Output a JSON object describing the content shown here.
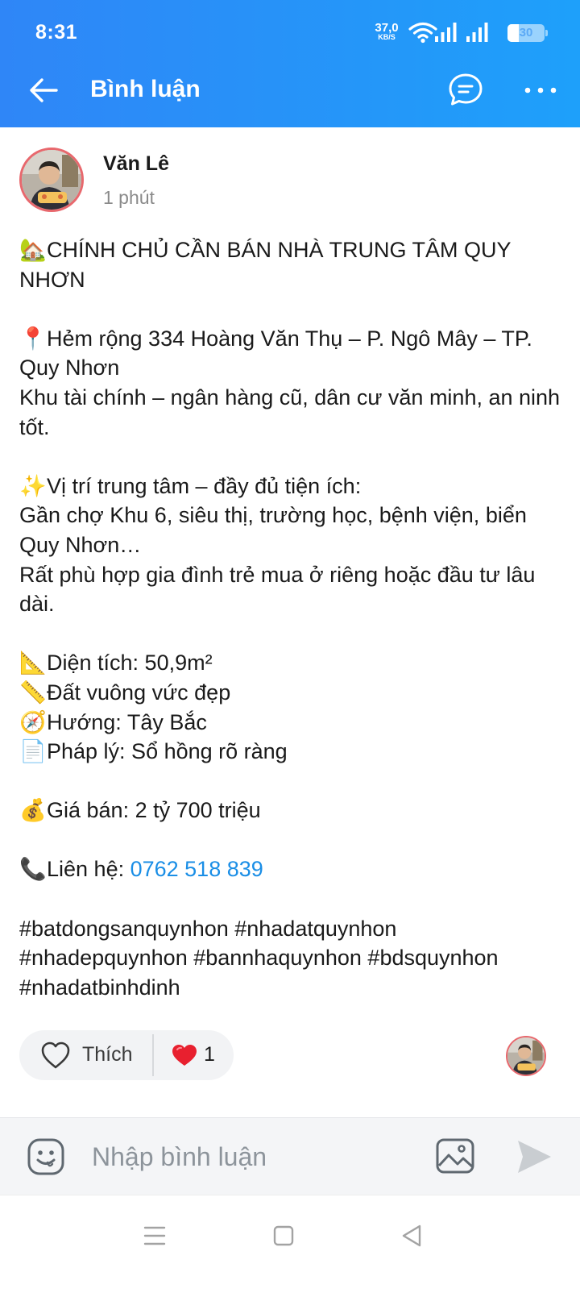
{
  "status_bar": {
    "time": "8:31",
    "net_speed_value": "37,0",
    "net_speed_unit": "KB/S",
    "battery_level": "30"
  },
  "nav": {
    "title": "Bình luận",
    "icons": {
      "back": "arrow-left",
      "chat": "chat-bubble",
      "more": "more-horizontal"
    }
  },
  "post": {
    "author": "Văn Lê",
    "time": "1 phút",
    "emoji": {
      "house": "🏡",
      "pin": "📍",
      "sparkles": "✨",
      "triangle_ruler": "📐",
      "ruler": "📏",
      "compass": "🧭",
      "document": "📄",
      "money_bag": "💰",
      "phone": "📞"
    },
    "lines": {
      "headline": "CHÍNH CHỦ CẦN BÁN NHÀ TRUNG TÂM QUY NHƠN",
      "address": "Hẻm rộng 334 Hoàng Văn Thụ – P. Ngô Mây – TP. Quy Nhơn",
      "area_desc": "Khu tài chính – ngân hàng cũ, dân cư văn minh, an ninh tốt.",
      "location": "Vị trí trung tâm – đầy đủ tiện ích:",
      "nearby": "Gần chợ Khu 6, siêu thị, trường học, bệnh viện, biển Quy Nhơn…",
      "suitable": "Rất phù hợp gia đình trẻ mua ở riêng hoặc đầu tư lâu dài.",
      "size": "Diện tích: 50,9m²",
      "shape": "Đất vuông vức đẹp",
      "direction": "Hướng: Tây Bắc",
      "legal": "Pháp lý: Sổ hồng rõ ràng",
      "price": "Giá bán: 2 tỷ 700 triệu",
      "contact_label": "Liên hệ: ",
      "contact_phone": "0762 518 839",
      "hashtags": "#batdongsanquynhon #nhadatquynhon #nhadepquynhon #bannhaquynhon #bdsquynhon #nhadatbinhdinh"
    }
  },
  "reactions": {
    "like_label": "Thích",
    "heart_count": "1"
  },
  "comment_bar": {
    "placeholder": "Nhập bình luận"
  },
  "colors": {
    "header_start": "#2f86f7",
    "header_end": "#1ea0fa",
    "link": "#1a8ee6",
    "avatar_ring": "#e8686d"
  }
}
